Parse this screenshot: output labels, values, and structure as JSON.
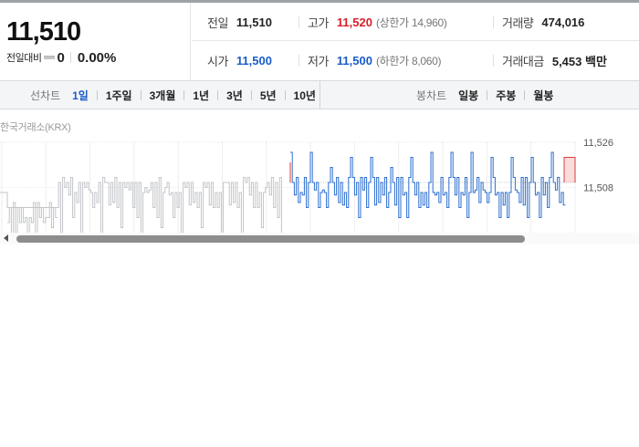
{
  "price": {
    "current": "11,510",
    "change_label": "전일대비",
    "change_icon": "flat-dash-icon",
    "change_value": "0",
    "change_percent": "0.00%"
  },
  "stats": {
    "prev_close": {
      "label": "전일",
      "value": "11,510"
    },
    "high": {
      "label": "고가",
      "value": "11,520",
      "limit_label": "상한가",
      "limit_value": "14,960"
    },
    "volume": {
      "label": "거래량",
      "value": "474,016"
    },
    "open": {
      "label": "시가",
      "value": "11,500"
    },
    "low": {
      "label": "저가",
      "value": "11,500",
      "limit_label": "하한가",
      "limit_value": "8,060"
    },
    "trade_value": {
      "label": "거래대금",
      "value": "5,453 백만"
    }
  },
  "line_chart_tabs": {
    "label": "선차트",
    "items": [
      "1일",
      "1주일",
      "3개월",
      "1년",
      "3년",
      "5년",
      "10년"
    ],
    "active_index": 0
  },
  "candle_chart_tabs": {
    "label": "봉차트",
    "items": [
      "일봉",
      "주봉",
      "월봉"
    ]
  },
  "chart_data": {
    "type": "line",
    "exchange_label": "한국거래소(KRX)",
    "y_ticks": [
      "11,526",
      "11,508"
    ],
    "y_tick_values": [
      11526,
      11508
    ],
    "ylim": [
      11490,
      11530
    ],
    "grid": true,
    "previous_session": {
      "color": "#c3c5c9",
      "values": [
        11500,
        11510,
        11490,
        11510,
        11508,
        11510,
        11505,
        11510,
        11500,
        11510
      ]
    },
    "current_session": {
      "color": "#2e6fd0",
      "values": [
        11520,
        11510,
        11505,
        11510,
        11500,
        11510,
        11505,
        11510,
        11500,
        11510
      ]
    },
    "high_marker_color": "#e03b3b"
  },
  "colors": {
    "up": "#d8202a",
    "down": "#1a5cc8",
    "active_tab": "#1a5cc8"
  }
}
